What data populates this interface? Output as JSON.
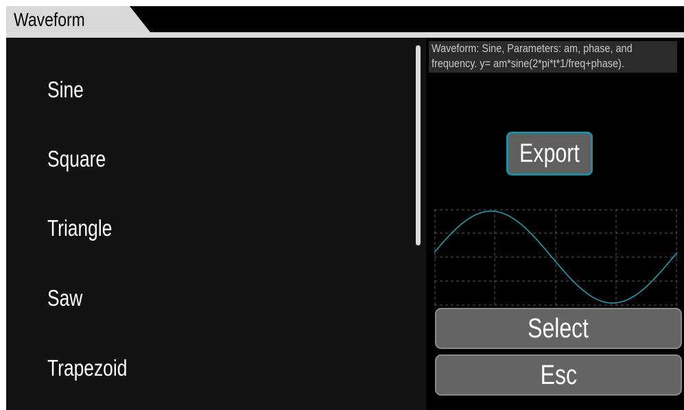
{
  "title": "Waveform",
  "waveforms": [
    "Sine",
    "Square",
    "Triangle",
    "Saw",
    "Trapezoid"
  ],
  "selected_index": 0,
  "description_lines": [
    "Waveform: Sine, Parameters: am, phase, and",
    "frequency. y= am*sine(2*pi*t*1/freq+phase)."
  ],
  "buttons": {
    "export": "Export",
    "select": "Select",
    "esc": "Esc"
  },
  "colors": {
    "accent": "#1f8fa4",
    "wave": "#1aa7b8",
    "selected_bg": "#8c8a8b",
    "button_bg": "#646464"
  }
}
